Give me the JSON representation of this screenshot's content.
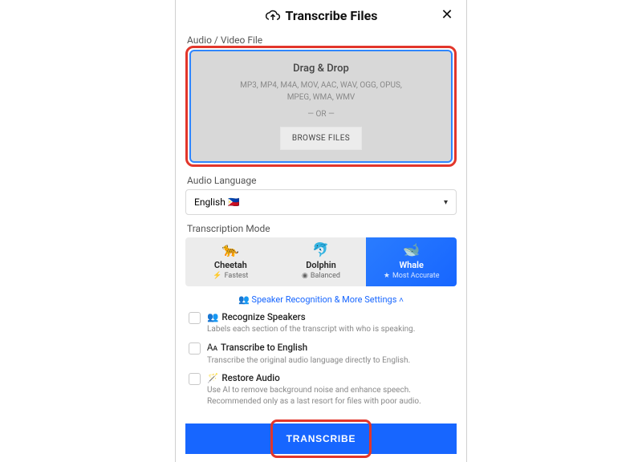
{
  "header": {
    "title": "Transcribe Files"
  },
  "dropzone": {
    "field_label": "Audio / Video File",
    "title": "Drag & Drop",
    "formats": "MP3, MP4, M4A, MOV, AAC, WAV, OGG, OPUS, MPEG, WMA, WMV",
    "or": "— OR —",
    "browse": "BROWSE FILES"
  },
  "language": {
    "label": "Audio Language",
    "value": "English 🇵🇭"
  },
  "modes": {
    "label": "Transcription Mode",
    "items": [
      {
        "emoji": "🐆",
        "name": "Cheetah",
        "sub_icon": "⚡",
        "sub": "Fastest"
      },
      {
        "emoji": "🐬",
        "name": "Dolphin",
        "sub_icon": "◉",
        "sub": "Balanced"
      },
      {
        "emoji": "🐋",
        "name": "Whale",
        "sub_icon": "★",
        "sub": "Most Accurate"
      }
    ]
  },
  "more": {
    "label": "👥 Speaker Recognition & More Settings"
  },
  "options": [
    {
      "icon": "👥",
      "title": "Recognize Speakers",
      "desc": "Labels each section of the transcript with who is speaking."
    },
    {
      "icon": "🗛",
      "title": "Transcribe to English",
      "desc": "Transcribe the original audio language directly to English."
    },
    {
      "icon": "🪄",
      "title": "Restore Audio",
      "desc": "Use AI to remove background noise and enhance speech. Recommended only as a last resort for files with poor audio."
    }
  ],
  "submit": {
    "label": "TRANSCRIBE"
  }
}
